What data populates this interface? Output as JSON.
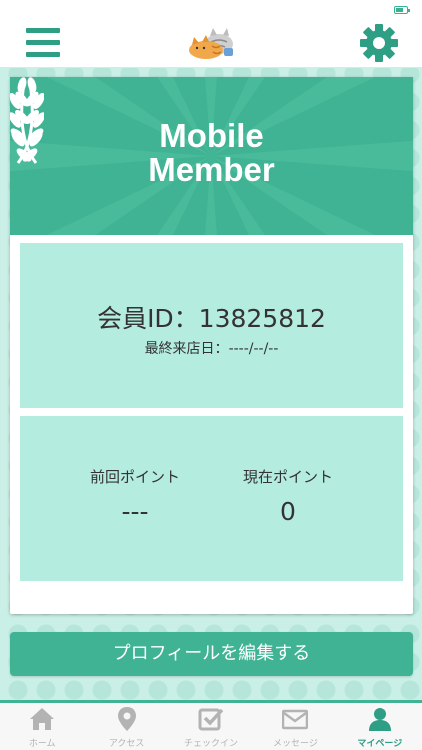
{
  "header": {
    "menu_icon": "hamburger-menu-icon",
    "logo_icon": "cats-logo-icon",
    "settings_icon": "gear-icon",
    "accent_color": "#2e9e84"
  },
  "member_card": {
    "title_line1": "Mobile",
    "title_line2": "Member",
    "member_id": "会員ID：13825812",
    "last_visit_label": "最終来店日：",
    "last_visit_value": "----/--/--",
    "previous_points_label": "前回ポイント",
    "previous_points_value": "---",
    "current_points_label": "現在ポイント",
    "current_points_value": "0"
  },
  "actions": {
    "edit_profile_label": "プロフィールを編集する"
  },
  "tabbar": {
    "items": [
      {
        "label": "ホーム",
        "icon": "home-icon",
        "active": false
      },
      {
        "label": "アクセス",
        "icon": "map-pin-icon",
        "active": false
      },
      {
        "label": "チェックイン",
        "icon": "checkin-icon",
        "active": false
      },
      {
        "label": "メッセージ",
        "icon": "mail-icon",
        "active": false
      },
      {
        "label": "マイページ",
        "icon": "user-icon",
        "active": true
      }
    ]
  },
  "colors": {
    "brand": "#3fb393",
    "panel": "#b5ece0",
    "background": "#c9efe6",
    "inactive_tab": "#b3b3b3"
  }
}
